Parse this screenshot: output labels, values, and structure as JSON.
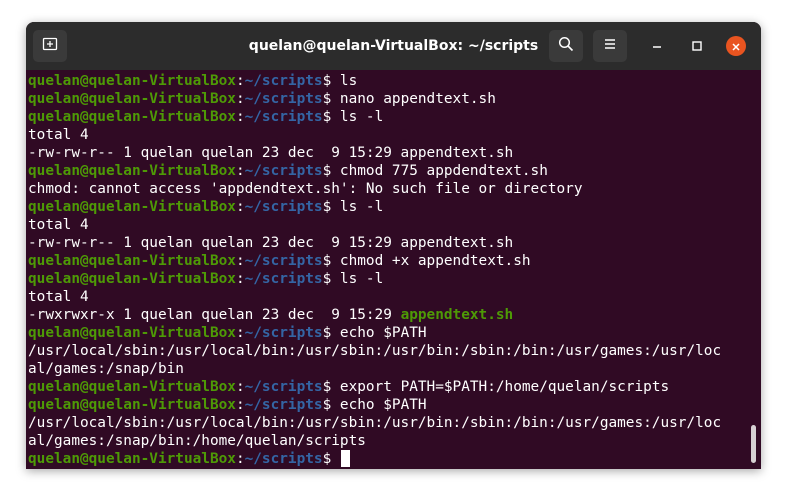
{
  "window": {
    "title": "quelan@quelan-VirtualBox: ~/scripts"
  },
  "colors": {
    "terminal_bg": "#300a24",
    "user_host": "#4e9a06",
    "path": "#3465a4",
    "executable": "#4e9a06",
    "titlebar": "#2c2c2c",
    "close_button": "#e95420"
  },
  "icons": {
    "new_tab": "new-tab-icon",
    "search": "search-icon",
    "menu": "hamburger-menu-icon",
    "minimize": "minimize-icon",
    "maximize": "maximize-icon",
    "close": "close-icon"
  },
  "prompt": {
    "user_host": "quelan@quelan-VirtualBox",
    "colon": ":",
    "path": "~/scripts",
    "dollar": "$ "
  },
  "lines": [
    {
      "type": "prompt",
      "command": "ls"
    },
    {
      "type": "prompt",
      "command": "nano appendtext.sh"
    },
    {
      "type": "prompt",
      "command": "ls -l"
    },
    {
      "type": "output",
      "text": "total 4"
    },
    {
      "type": "output",
      "text": "-rw-rw-r-- 1 quelan quelan 23 dec  9 15:29 appendtext.sh"
    },
    {
      "type": "prompt",
      "command": "chmod 775 appdendtext.sh"
    },
    {
      "type": "output",
      "text": "chmod: cannot access 'appdendtext.sh': No such file or directory"
    },
    {
      "type": "prompt",
      "command": "ls -l"
    },
    {
      "type": "output",
      "text": "total 4"
    },
    {
      "type": "output",
      "text": "-rw-rw-r-- 1 quelan quelan 23 dec  9 15:29 appendtext.sh"
    },
    {
      "type": "prompt",
      "command": "chmod +x appendtext.sh"
    },
    {
      "type": "prompt",
      "command": "ls -l"
    },
    {
      "type": "output",
      "text": "total 4"
    },
    {
      "type": "listing_exec",
      "text": "-rwxrwxr-x 1 quelan quelan 23 dec  9 15:29 ",
      "filename": "appendtext.sh"
    },
    {
      "type": "prompt",
      "command": "echo $PATH"
    },
    {
      "type": "output",
      "text": "/usr/local/sbin:/usr/local/bin:/usr/sbin:/usr/bin:/sbin:/bin:/usr/games:/usr/loc"
    },
    {
      "type": "output",
      "text": "al/games:/snap/bin"
    },
    {
      "type": "prompt",
      "command": "export PATH=$PATH:/home/quelan/scripts"
    },
    {
      "type": "prompt",
      "command": "echo $PATH"
    },
    {
      "type": "output",
      "text": "/usr/local/sbin:/usr/local/bin:/usr/sbin:/usr/bin:/sbin:/bin:/usr/games:/usr/loc"
    },
    {
      "type": "output",
      "text": "al/games:/snap/bin:/home/quelan/scripts"
    },
    {
      "type": "prompt",
      "command": ""
    }
  ]
}
